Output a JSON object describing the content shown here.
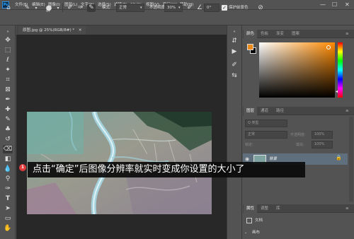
{
  "app": {
    "logo": "Ps"
  },
  "menubar": {
    "items": [
      "文件(F)",
      "编辑(E)",
      "图像(I)",
      "图层(L)",
      "文字(Y)",
      "选择(S)",
      "滤镜(T)",
      "3D(D)",
      "视图(V)",
      "窗口(W)",
      "帮助(H)"
    ],
    "window_controls": [
      "—",
      "☐",
      "✕"
    ]
  },
  "options_bar": {
    "brush_size": "97",
    "mode_label": "模式:",
    "mode_value": "正常",
    "opacity_label": "不透明度:",
    "opacity_value": "30%",
    "angle_value": "0°",
    "protect_label": "保护前景色"
  },
  "document": {
    "tab_title": "原图.jpg @ 25%(RGB/8#) *",
    "tab_close": "✕"
  },
  "panels": {
    "top_tabs": [
      "颜色",
      "色板",
      "渐变",
      "图案"
    ],
    "color": {
      "foreground": "#ec8a1a",
      "background": "#000000"
    },
    "layers_tabs": [
      "图层",
      "通道",
      "路径"
    ],
    "layers": {
      "kind_placeholder": "Q 类型",
      "blend_mode": "正常",
      "opacity_label": "不透明度:",
      "opacity_value": "100%",
      "lock_label": "锁定:",
      "fill_label": "填充:",
      "fill_value": "100%",
      "layer_name": "背景"
    },
    "properties_tabs": [
      "属性",
      "调整",
      "库"
    ],
    "properties": {
      "doc_label": "文档",
      "section_title": "画布"
    }
  },
  "caption": {
    "badge": "1",
    "text": "点击“确定”后图像分辨率就实时变成你设置的大小了"
  }
}
